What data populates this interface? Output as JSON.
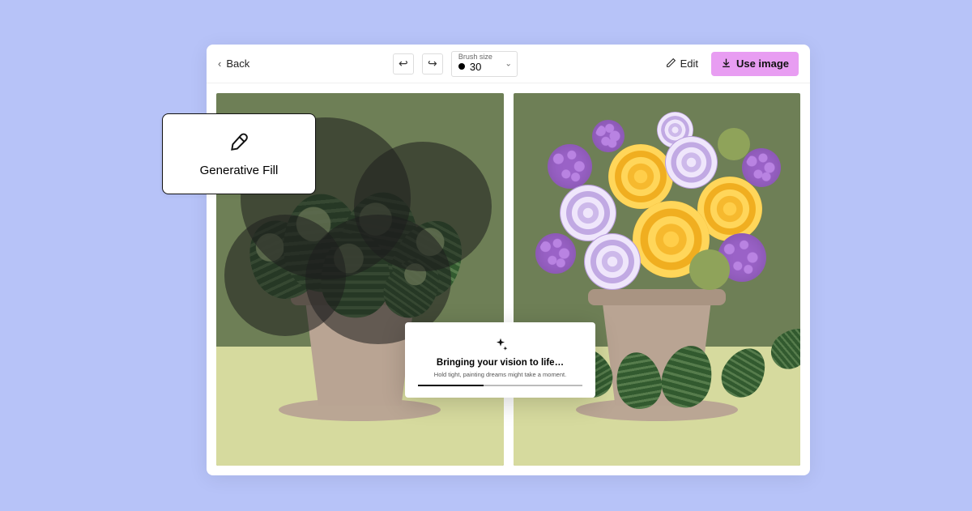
{
  "toolbar": {
    "back": "Back",
    "brush_label": "Brush size",
    "brush_value": "30",
    "edit": "Edit",
    "use_image": "Use image"
  },
  "genfill": {
    "label": "Generative Fill"
  },
  "loading": {
    "title": "Bringing your vision to life…",
    "subtitle": "Hold tight, painting dreams might take a moment."
  }
}
